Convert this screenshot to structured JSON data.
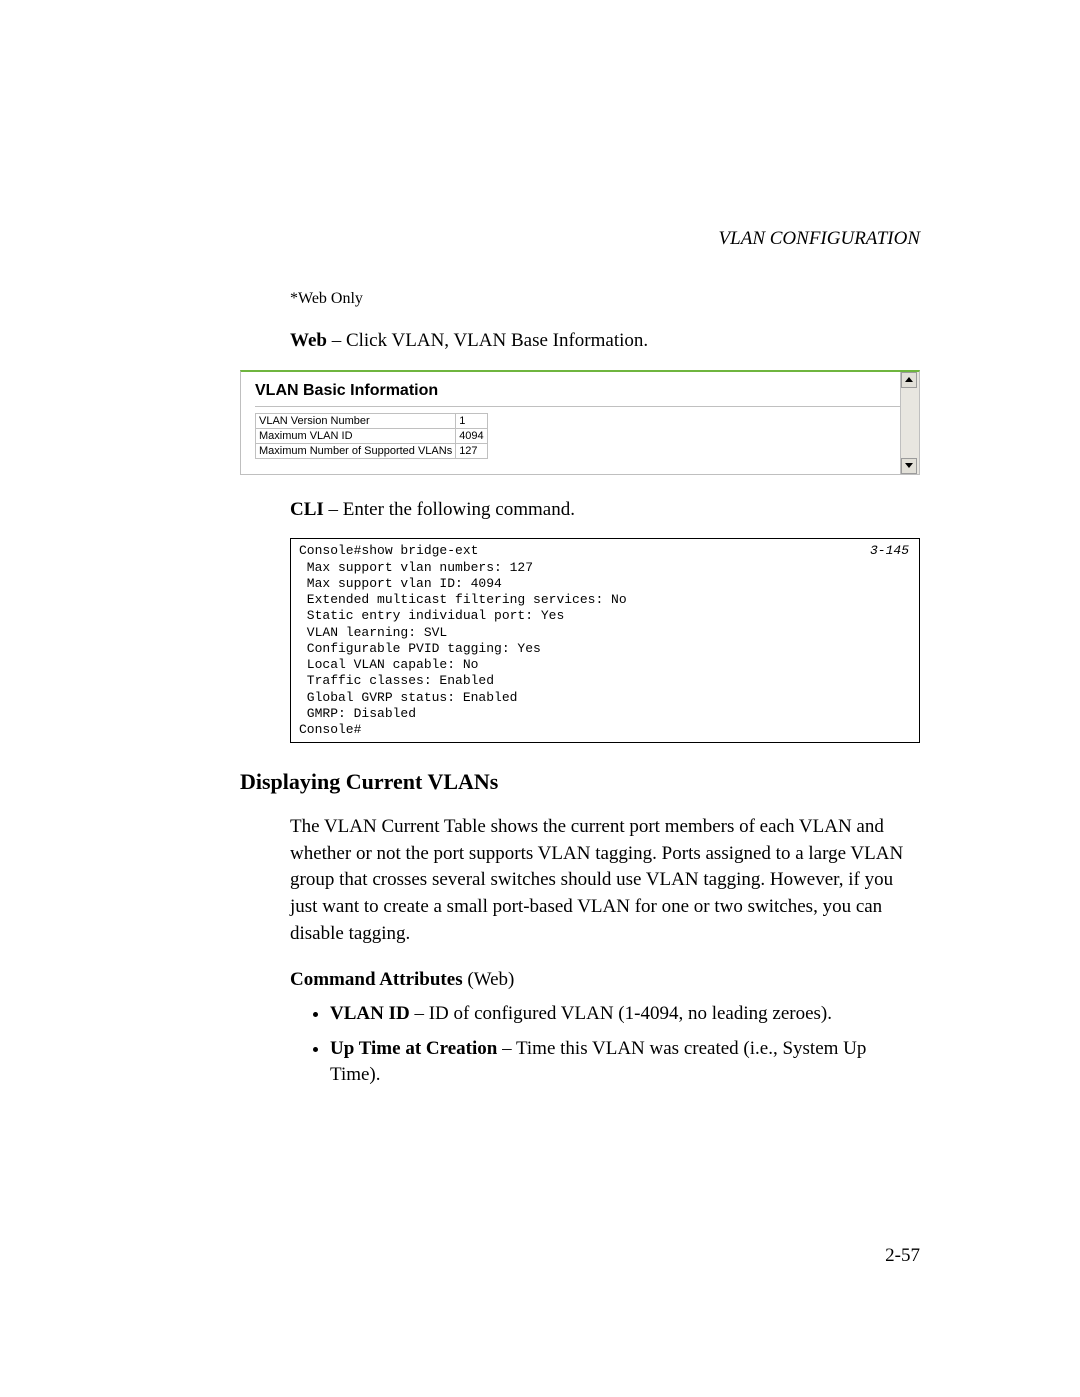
{
  "header": {
    "title_main": "VLAN C",
    "title_caps": "ONFIGURATION"
  },
  "footnote": "*Web Only",
  "web_line": {
    "bold": "Web",
    "rest": " – Click VLAN, VLAN Base Information."
  },
  "web_ui": {
    "title": "VLAN Basic Information",
    "rows": [
      {
        "label": "VLAN Version Number",
        "value": "1"
      },
      {
        "label": "Maximum VLAN ID",
        "value": "4094"
      },
      {
        "label": "Maximum Number of Supported VLANs",
        "value": "127"
      }
    ]
  },
  "cli_line": {
    "bold": "CLI",
    "rest": " – Enter the following command."
  },
  "cli": {
    "ref": "3-145",
    "text": "Console#show bridge-ext\n Max support vlan numbers: 127\n Max support vlan ID: 4094\n Extended multicast filtering services: No\n Static entry individual port: Yes\n VLAN learning: SVL\n Configurable PVID tagging: Yes\n Local VLAN capable: No\n Traffic classes: Enabled\n Global GVRP status: Enabled\n GMRP: Disabled\nConsole#"
  },
  "section_heading": "Displaying Current VLANs",
  "section_body": "The VLAN Current Table shows the current port members of each VLAN and whether or not the port supports VLAN tagging. Ports assigned to a large VLAN group that crosses several switches should use VLAN tagging. However, if you just want to create a small port-based VLAN for one or two switches, you can disable tagging.",
  "cmd_attr_heading": {
    "bold": "Command Attributes",
    "rest": " (Web)"
  },
  "bullets": [
    {
      "bold": "VLAN ID",
      "rest": " – ID of configured VLAN (1-4094, no leading zeroes)."
    },
    {
      "bold": "Up Time at Creation",
      "rest": " – Time this VLAN was created (i.e., System Up Time)."
    }
  ],
  "page_number": "2-57"
}
